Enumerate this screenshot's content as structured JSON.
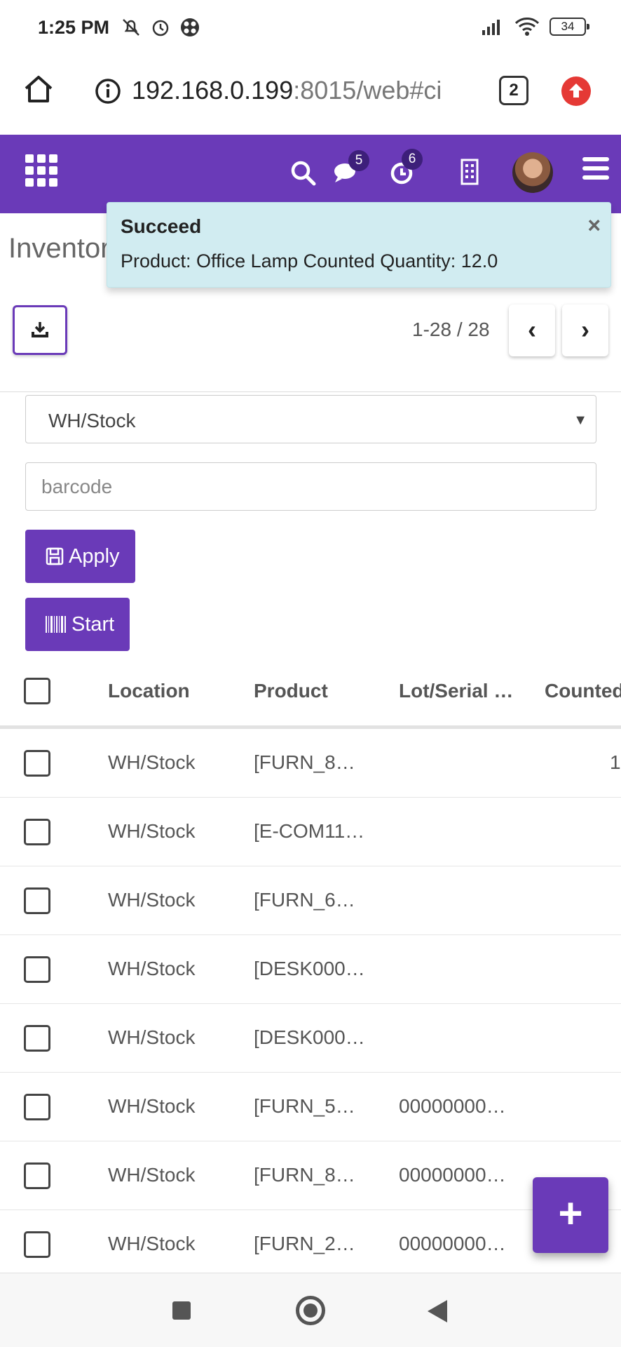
{
  "status_bar": {
    "time": "1:25 PM",
    "battery": "34",
    "icons": [
      "mute-icon",
      "alarm-icon",
      "app-icon",
      "signal-icon",
      "wifi-icon",
      "battery-icon"
    ]
  },
  "browser": {
    "url_host": "192.168.0.199",
    "url_rest": ":8015/web#ci",
    "tab_count": "2"
  },
  "nav": {
    "messages_badge": "5",
    "activities_badge": "6"
  },
  "page": {
    "title": "Inventor"
  },
  "toast": {
    "title": "Succeed",
    "message": "Product: Office Lamp Counted Quantity: 12.0",
    "close": "×"
  },
  "pager": {
    "range": "1-28 / 28",
    "prev": "‹",
    "next": "›"
  },
  "filters": {
    "location_value": "WH/Stock",
    "barcode_placeholder": "barcode",
    "apply_label": "Apply",
    "start_label": "Start"
  },
  "table": {
    "columns": [
      "Location",
      "Product",
      "Lot/Serial …",
      "Counted"
    ],
    "rows": [
      {
        "location": "WH/Stock",
        "product": "[FURN_8…",
        "lot": "",
        "counted": "1"
      },
      {
        "location": "WH/Stock",
        "product": "[E-COM11…",
        "lot": "",
        "counted": ""
      },
      {
        "location": "WH/Stock",
        "product": "[FURN_6…",
        "lot": "",
        "counted": ""
      },
      {
        "location": "WH/Stock",
        "product": "[DESK000…",
        "lot": "",
        "counted": ""
      },
      {
        "location": "WH/Stock",
        "product": "[DESK000…",
        "lot": "",
        "counted": ""
      },
      {
        "location": "WH/Stock",
        "product": "[FURN_5…",
        "lot": "00000000…",
        "counted": ""
      },
      {
        "location": "WH/Stock",
        "product": "[FURN_8…",
        "lot": "00000000…",
        "counted": ""
      },
      {
        "location": "WH/Stock",
        "product": "[FURN_2…",
        "lot": "00000000…",
        "counted": ""
      }
    ]
  },
  "fab": {
    "label": "+"
  },
  "colors": {
    "brand": "#6a3ab8",
    "toast_bg": "#d1ecf1",
    "badge_bg": "#3d1f7a"
  }
}
